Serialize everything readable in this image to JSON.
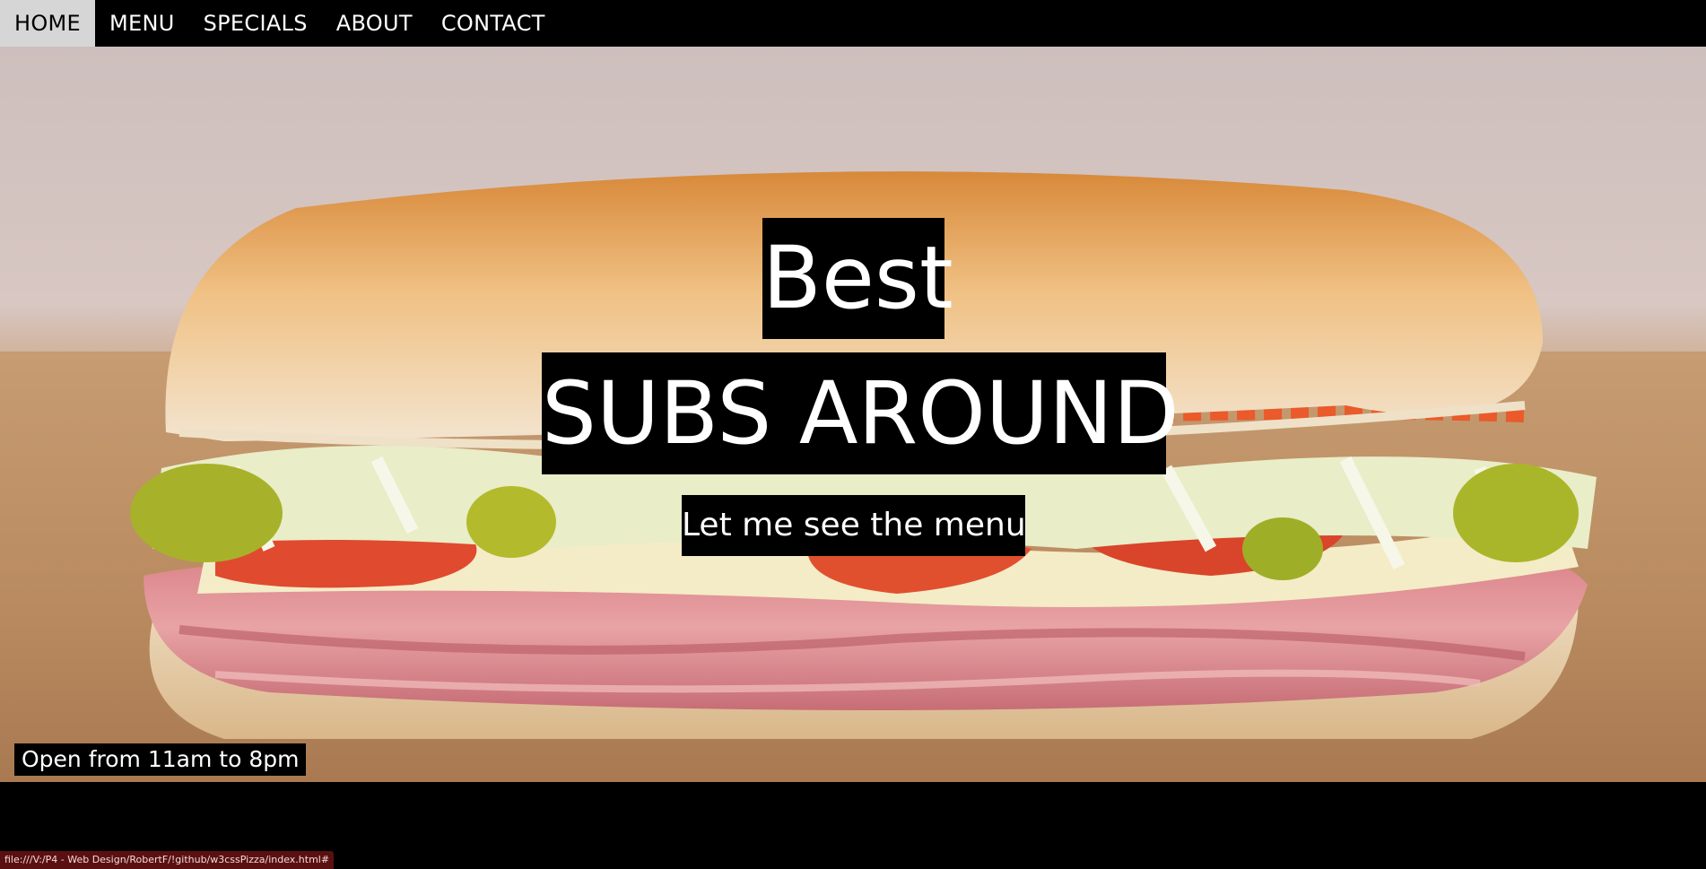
{
  "nav": {
    "items": [
      {
        "label": "HOME",
        "active": true
      },
      {
        "label": "MENU",
        "active": false
      },
      {
        "label": "SPECIALS",
        "active": false
      },
      {
        "label": "ABOUT",
        "active": false
      },
      {
        "label": "CONTACT",
        "active": false
      }
    ]
  },
  "hero": {
    "headline_line1": "Best",
    "headline_line2": "SUBS AROUND",
    "cta_label": "Let me see the menu",
    "hours_text": "Open from 11am to 8pm"
  },
  "browser": {
    "status_url": "file:///V:/P4 - Web Design/RobertF/!github/w3cssPizza/index.html#"
  },
  "colors": {
    "nav_bg": "#000000",
    "nav_active_bg": "#d6d6d6",
    "caption_bg": "#000000",
    "caption_text": "#ffffff"
  }
}
